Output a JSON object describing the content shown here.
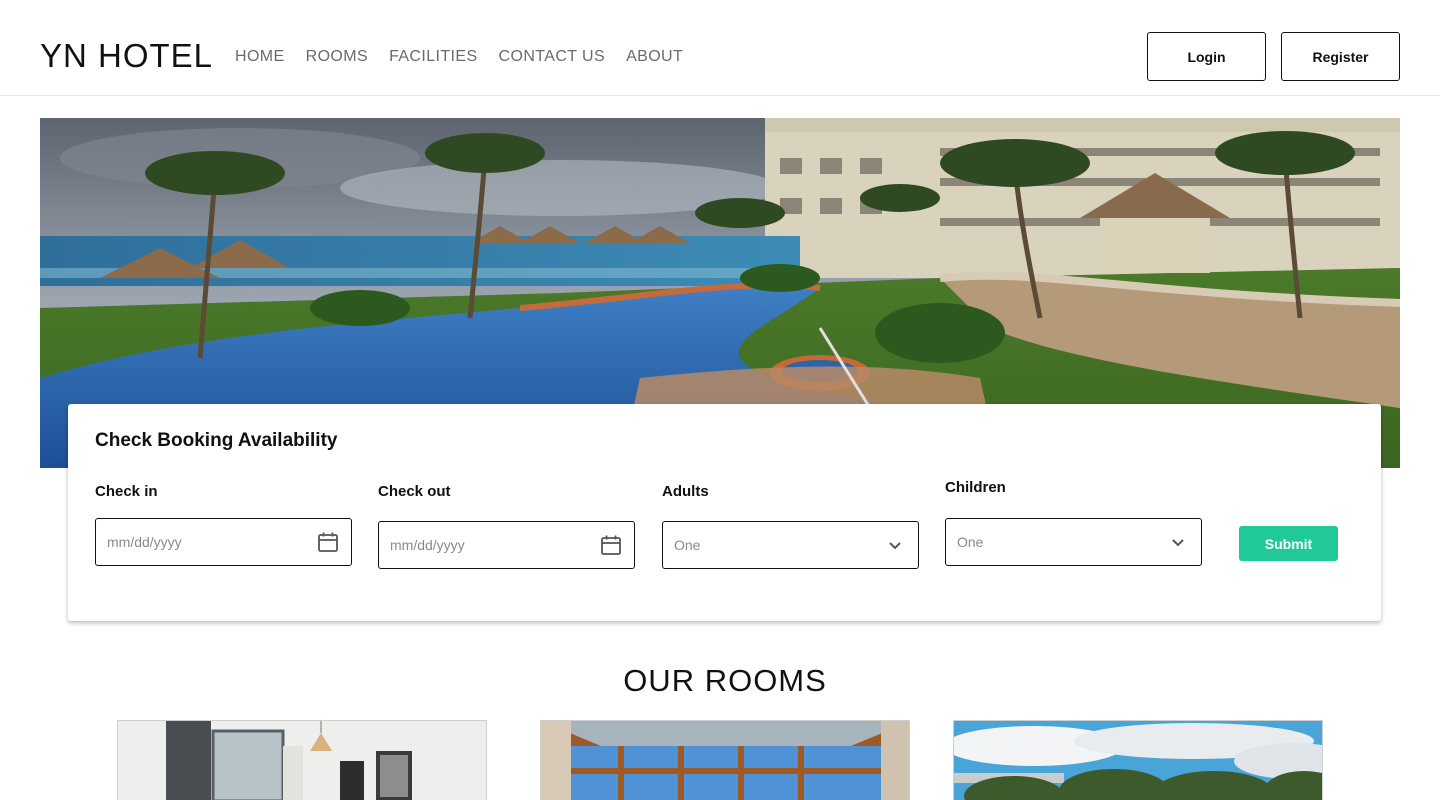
{
  "header": {
    "logo": "YN HOTEL",
    "nav": [
      "HOME",
      "ROOMS",
      "FACILITIES",
      "CONTACT US",
      "ABOUT"
    ],
    "login_label": "Login",
    "register_label": "Register"
  },
  "booking": {
    "title": "Check Booking Availability",
    "checkin_label": "Check in",
    "checkin_placeholder": "mm/dd/yyyy",
    "checkout_label": "Check out",
    "checkout_placeholder": "mm/dd/yyyy",
    "adults_label": "Adults",
    "adults_value": "One",
    "children_label": "Children",
    "children_value": "One",
    "submit_label": "Submit"
  },
  "rooms": {
    "title": "OUR ROOMS"
  },
  "colors": {
    "accent": "#20c997",
    "text": "#111111",
    "nav": "#6b6b6b"
  },
  "icons": [
    "calendar-icon",
    "chevron-down-icon"
  ]
}
